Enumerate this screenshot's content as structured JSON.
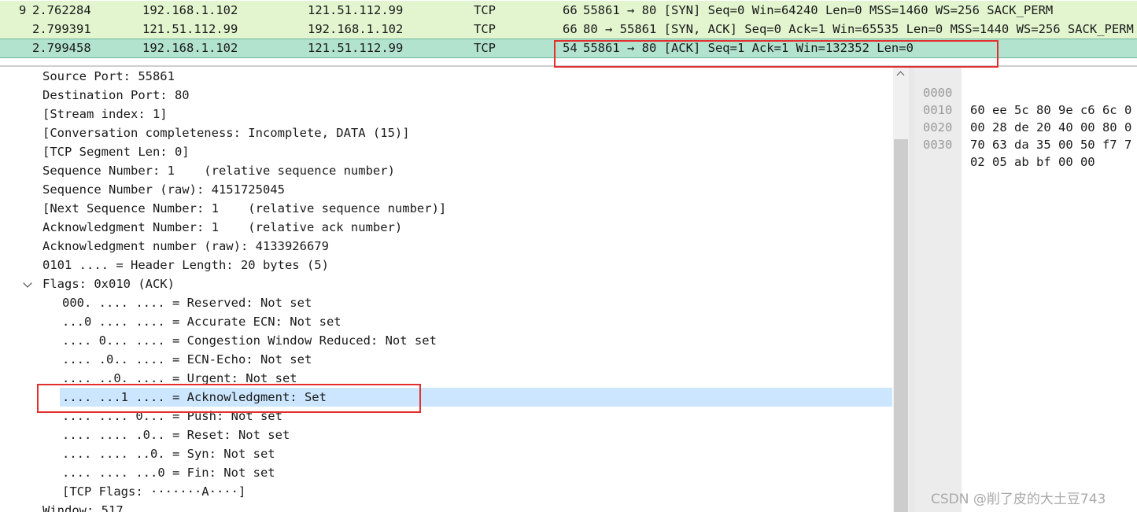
{
  "packet_list": {
    "rows": [
      {
        "no": "9",
        "time": "2.762284",
        "source": "192.168.1.102",
        "destination": "121.51.112.99",
        "protocol": "TCP",
        "length": "66",
        "info": "55861 → 80 [SYN] Seq=0 Win=64240 Len=0 MSS=1460 WS=256 SACK_PERM"
      },
      {
        "no": "",
        "time": "2.799391",
        "source": "121.51.112.99",
        "destination": "192.168.1.102",
        "protocol": "TCP",
        "length": "66",
        "info": "80 → 55861 [SYN, ACK] Seq=0 Ack=1 Win=65535 Len=0 MSS=1440 WS=256 SACK_PERM"
      },
      {
        "no": "",
        "time": "2.799458",
        "source": "192.168.1.102",
        "destination": "121.51.112.99",
        "protocol": "TCP",
        "length": "54",
        "info": "55861 → 80 [ACK] Seq=1 Ack=1 Win=132352 Len=0"
      }
    ]
  },
  "details": {
    "lines": [
      "Source Port: 55861",
      "Destination Port: 80",
      "[Stream index: 1]",
      "[Conversation completeness: Incomplete, DATA (15)]",
      "[TCP Segment Len: 0]",
      "Sequence Number: 1    (relative sequence number)",
      "Sequence Number (raw): 4151725045",
      "[Next Sequence Number: 1    (relative sequence number)]",
      "Acknowledgment Number: 1    (relative ack number)",
      "Acknowledgment number (raw): 4133926679",
      "0101 .... = Header Length: 20 bytes (5)",
      "Flags: 0x010 (ACK)"
    ],
    "flags": [
      "000. .... .... = Reserved: Not set",
      "...0 .... .... = Accurate ECN: Not set",
      ".... 0... .... = Congestion Window Reduced: Not set",
      ".... .0.. .... = ECN-Echo: Not set",
      ".... ..0. .... = Urgent: Not set",
      ".... ...1 .... = Acknowledgment: Set",
      ".... .... 0... = Push: Not set",
      ".... .... .0.. = Reset: Not set",
      ".... .... ..0. = Syn: Not set",
      ".... .... ...0 = Fin: Not set",
      "[TCP Flags: ·······A····]"
    ],
    "after": "Window: 517"
  },
  "bytes": {
    "rows": [
      {
        "offset": "0000",
        "hex": "60 ee 5c 80 9e c6 6c 0"
      },
      {
        "offset": "0010",
        "hex": "00 28 de 20 40 00 80 0"
      },
      {
        "offset": "0020",
        "hex": "70 63 da 35 00 50 f7 7"
      },
      {
        "offset": "0030",
        "hex": "02 05 ab bf 00 00"
      }
    ]
  },
  "watermark": "CSDN @削了皮的大土豆743"
}
